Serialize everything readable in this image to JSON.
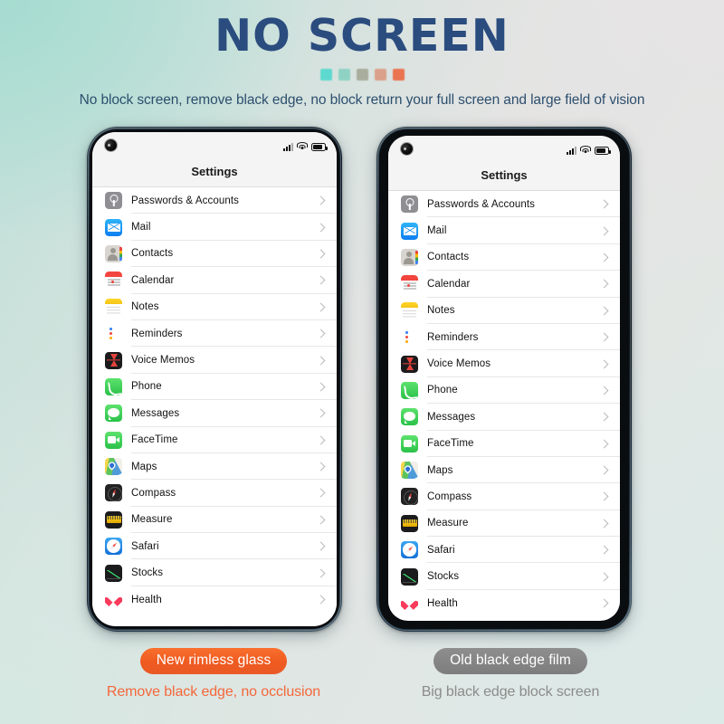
{
  "header": {
    "title": "NO SCREEN",
    "subtitle": "No block screen, remove black edge, no block return your full screen and large field of vision",
    "title_color": "#2b4c7e",
    "subtitle_color": "#2d4f6e",
    "dots": [
      {
        "name": "dot-turquoise",
        "color": "#5ed9cf"
      },
      {
        "name": "dot-mint",
        "color": "#8fd2c4"
      },
      {
        "name": "dot-sage",
        "color": "#a9ad9c"
      },
      {
        "name": "dot-peach",
        "color": "#dba089"
      },
      {
        "name": "dot-coral",
        "color": "#ea7350"
      }
    ]
  },
  "phones": [
    {
      "id": "left",
      "variant": "rimless",
      "statusbar": {
        "camera": "punch-hole-camera",
        "signal_icon": "signal-bars-icon",
        "wifi_icon": "wifi-icon",
        "battery_icon": "battery-icon"
      },
      "screen_title": "Settings"
    },
    {
      "id": "right",
      "variant": "black-edge-film",
      "statusbar": {
        "camera": "punch-hole-camera",
        "signal_icon": "signal-bars-icon",
        "wifi_icon": "wifi-icon",
        "battery_icon": "battery-icon"
      },
      "screen_title": "Settings"
    }
  ],
  "settings_list": [
    {
      "label": "Passwords & Accounts",
      "icon": "passwords-icon",
      "icon_class": "ic-passwords"
    },
    {
      "label": "Mail",
      "icon": "mail-icon",
      "icon_class": "ic-mail"
    },
    {
      "label": "Contacts",
      "icon": "contacts-icon",
      "icon_class": "ic-contacts"
    },
    {
      "label": "Calendar",
      "icon": "calendar-icon",
      "icon_class": "ic-calendar"
    },
    {
      "label": "Notes",
      "icon": "notes-icon",
      "icon_class": "ic-notes"
    },
    {
      "label": "Reminders",
      "icon": "reminders-icon",
      "icon_class": "ic-reminders"
    },
    {
      "label": "Voice Memos",
      "icon": "voice-memos-icon",
      "icon_class": "ic-voicememos"
    },
    {
      "label": "Phone",
      "icon": "phone-icon",
      "icon_class": "ic-phone"
    },
    {
      "label": "Messages",
      "icon": "messages-icon",
      "icon_class": "ic-messages"
    },
    {
      "label": "FaceTime",
      "icon": "facetime-icon",
      "icon_class": "ic-facetime"
    },
    {
      "label": "Maps",
      "icon": "maps-icon",
      "icon_class": "ic-maps"
    },
    {
      "label": "Compass",
      "icon": "compass-icon",
      "icon_class": "ic-compass"
    },
    {
      "label": "Measure",
      "icon": "measure-icon",
      "icon_class": "ic-measure"
    },
    {
      "label": "Safari",
      "icon": "safari-icon",
      "icon_class": "ic-safari"
    },
    {
      "label": "Stocks",
      "icon": "stocks-icon",
      "icon_class": "ic-stocks"
    },
    {
      "label": "Health",
      "icon": "health-icon",
      "icon_class": "ic-health"
    }
  ],
  "captions": {
    "left": {
      "pill": "New rimless glass",
      "sub": "Remove black edge, no occlusion",
      "pill_color": "#ef5a20",
      "sub_color": "#f4673a"
    },
    "right": {
      "pill": "Old black edge film",
      "sub": "Big black edge block screen",
      "pill_color": "#828282",
      "sub_color": "#8b8b8b"
    }
  }
}
